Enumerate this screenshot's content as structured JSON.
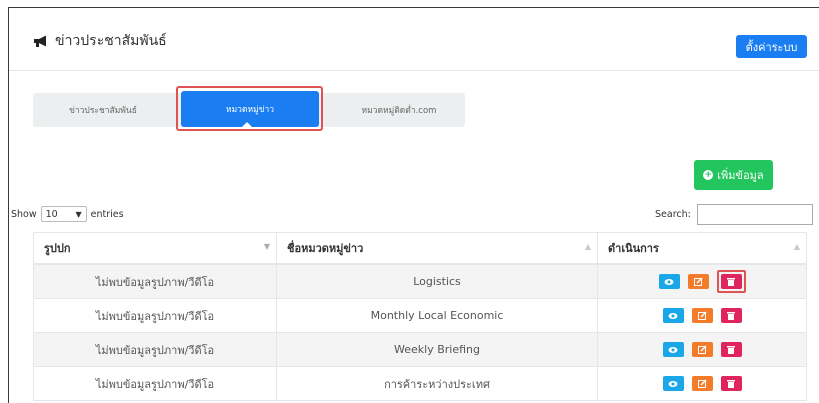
{
  "header": {
    "title": "ข่าวประชาสัมพันธ์",
    "settings_button": "ตั้งค่าระบบ"
  },
  "tabs": [
    {
      "label": "ข่าวประชาสัมพันธ์"
    },
    {
      "label": "หมวดหมู่ข่าว",
      "active": true
    },
    {
      "label": "หมวดหมู่ติดต่ำ.com"
    }
  ],
  "add_button": "เพิ่มข้อมูล",
  "table_controls": {
    "show_label": "Show",
    "entries_value": "10",
    "entries_label": "entries",
    "search_label": "Search:"
  },
  "table": {
    "columns": [
      "รูปปก",
      "ชื่อหมวดหมู่ข่าว",
      "ดำเนินการ"
    ],
    "rows": [
      {
        "cover": "ไม่พบข้อมูลรูปภาพ/วีดีโอ",
        "name": "Logistics"
      },
      {
        "cover": "ไม่พบข้อมูลรูปภาพ/วีดีโอ",
        "name": "Monthly Local Economic"
      },
      {
        "cover": "ไม่พบข้อมูลรูปภาพ/วีดีโอ",
        "name": "Weekly Briefing"
      },
      {
        "cover": "ไม่พบข้อมูลรูปภาพ/วีดีโอ",
        "name": "การค้าระหว่างประเทศ"
      }
    ]
  },
  "icons": {
    "title": "megaphone-icon",
    "view": "eye-icon",
    "edit": "edit-icon",
    "delete": "trash-icon",
    "add": "plus-circle-icon"
  },
  "colors": {
    "primary": "#1a7ef2",
    "success": "#22c55e",
    "info": "#1aa7e8",
    "warning": "#f47b2a",
    "danger": "#e0245e",
    "highlight": "#e05353"
  }
}
